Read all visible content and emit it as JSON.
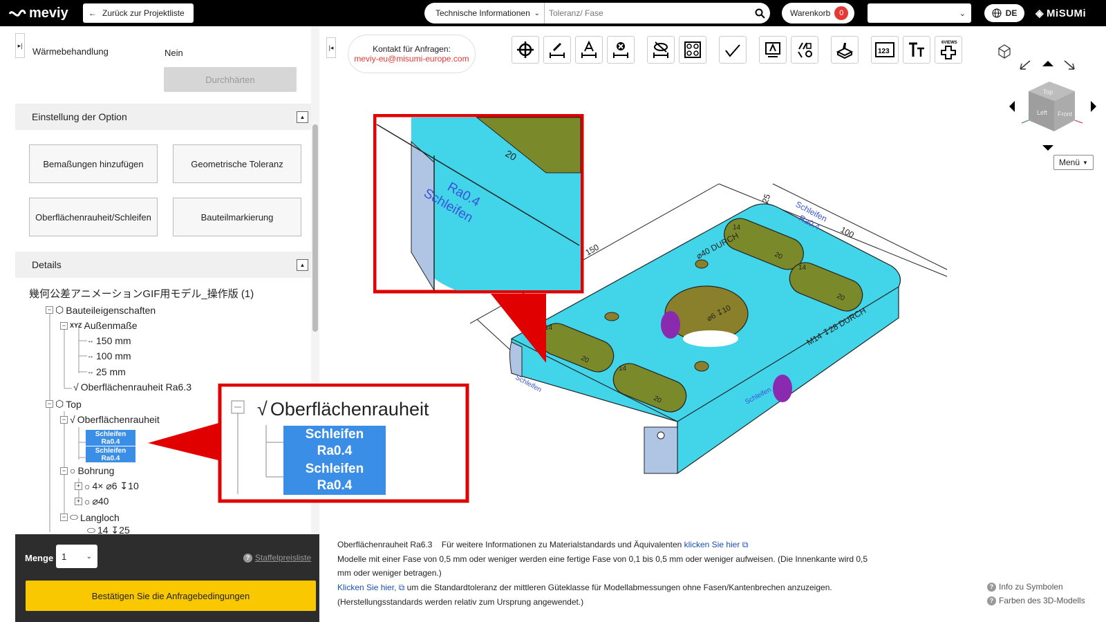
{
  "header": {
    "logo": "meviy",
    "back_label": "Zurück zur Projektliste",
    "search_category": "Technische Informationen",
    "search_placeholder": "Toleranz/ Fase",
    "cart_label": "Warenkorb",
    "cart_count": "0",
    "lang": "DE",
    "brand": "MiSUMi"
  },
  "left": {
    "waerme_label": "Wärmebehandlung",
    "waerme_value": "Nein",
    "durchhaerten": "Durchhärten",
    "option_section": "Einstellung der Option",
    "options": [
      "Bemaßungen hinzufügen",
      "Geometrische Toleranz",
      "Oberflächenrauheit/Schleifen",
      "Bauteilmarkierung"
    ],
    "details_section": "Details",
    "tree": {
      "root": "幾何公差アニメーションGIF用モデル_操作版 (1)",
      "bauteil": "Bauteileigenschaften",
      "aussen": "Außenmaße",
      "x_val": "150 mm",
      "y_val": "100 mm",
      "z_val": "25 mm",
      "rauheit_global": "Oberflächenrauheit Ra6.3",
      "top": "Top",
      "rauheit": "Oberflächenrauheit",
      "sel1_a": "Schleifen",
      "sel1_b": "Ra0.4",
      "sel2_a": "Schleifen",
      "sel2_b": "Ra0.4",
      "bohrung": "Bohrung",
      "bohr1": "4× ⌀6 ↧10",
      "bohr2": "⌀40",
      "langloch": "Langloch",
      "lang1": "14 ↧25"
    },
    "zoom": {
      "title": "Oberflächenrauheit",
      "a1": "Schleifen",
      "b1": "Ra0.4",
      "a2": "Schleifen",
      "b2": "Ra0.4"
    },
    "qty_label": "Menge",
    "qty_value": "1",
    "staffel": "Staffelpreisliste",
    "confirm": "Bestätigen Sie die Anfragebedingungen"
  },
  "viewer": {
    "contact_title": "Kontakt für Anfragen:",
    "contact_email": "meviy-eu@misumi-europe.com",
    "menu_label": "Menü",
    "cube_top": "Top",
    "cube_left": "Left",
    "cube_front": "Front",
    "sixviews": "6VIEWS",
    "dims": {
      "d150": "150",
      "d100": "100",
      "d25": "25",
      "d40": "⌀40 DURCH",
      "d14a": "14",
      "d14b": "14",
      "d14c": "14",
      "d14d": "14",
      "d20a": "20",
      "d20b": "20",
      "d20c": "20",
      "d20d": "20",
      "d6": "⌀6 ↧10",
      "m14": "M14 ↧28 DURCH",
      "schleifen": "Schleifen",
      "ra04": "Ra0.4"
    },
    "zoom_text": {
      "schleifen": "Schleifen",
      "ra04": "Ra0.4",
      "d20": "20"
    }
  },
  "info": {
    "line1_a": "Oberflächenrauheit Ra6.3",
    "line1_b": "Für weitere Informationen zu Materialstandards und Äquivalenten",
    "line1_link": "klicken Sie hier",
    "line2": "Modelle mit einer Fase von 0,5 mm oder weniger werden eine fertige Fase von 0,1 bis 0,5 mm oder weniger aufweisen. (Die Innenkante wird 0,5",
    "line3": "mm oder weniger betragen.)",
    "line4_link": "Klicken Sie hier,",
    "line4_b": "um die Standardtoleranz der mittleren Güteklasse für Modellabmessungen ohne Fasen/Kantenbrechen anzuzeigen.",
    "line5": "(Herstellungsstandards werden relativ zum Ursprung angewendet.)",
    "help1": "Info zu Symbolen",
    "help2": "Farben des 3D-Modells"
  },
  "colors": {
    "part": "#42d4e8",
    "hole": "#8a7f2a",
    "slot": "#7a8a2a",
    "highlight": "#e00000",
    "select": "#3b8ee6",
    "confirm": "#f9c800"
  }
}
